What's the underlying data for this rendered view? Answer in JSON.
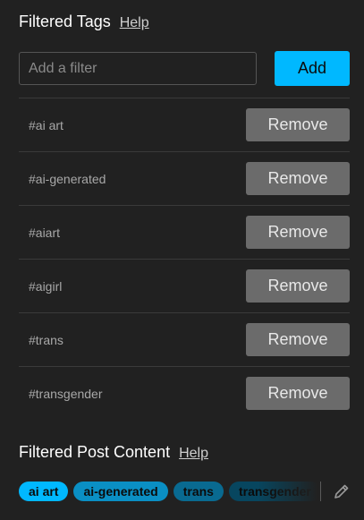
{
  "filtered_tags": {
    "title": "Filtered Tags",
    "help_label": "Help",
    "input_placeholder": "Add a filter",
    "input_value": "",
    "add_label": "Add",
    "remove_label": "Remove",
    "tags": [
      "#ai art",
      "#ai-generated",
      "#aiart",
      "#aigirl",
      "#trans",
      "#transgender"
    ]
  },
  "filtered_content": {
    "title": "Filtered Post Content",
    "help_label": "Help",
    "chips": [
      {
        "label": "ai art",
        "color": "#00b8ff"
      },
      {
        "label": "ai-generated",
        "color": "#0a8fc4"
      },
      {
        "label": "trans",
        "color": "#096a91"
      },
      {
        "label": "transgender",
        "color": "#07465f"
      }
    ],
    "edit_icon": "pencil-icon"
  },
  "colors": {
    "background": "#212121",
    "accent": "#00b8ff",
    "remove_button": "#6b6b6b"
  }
}
